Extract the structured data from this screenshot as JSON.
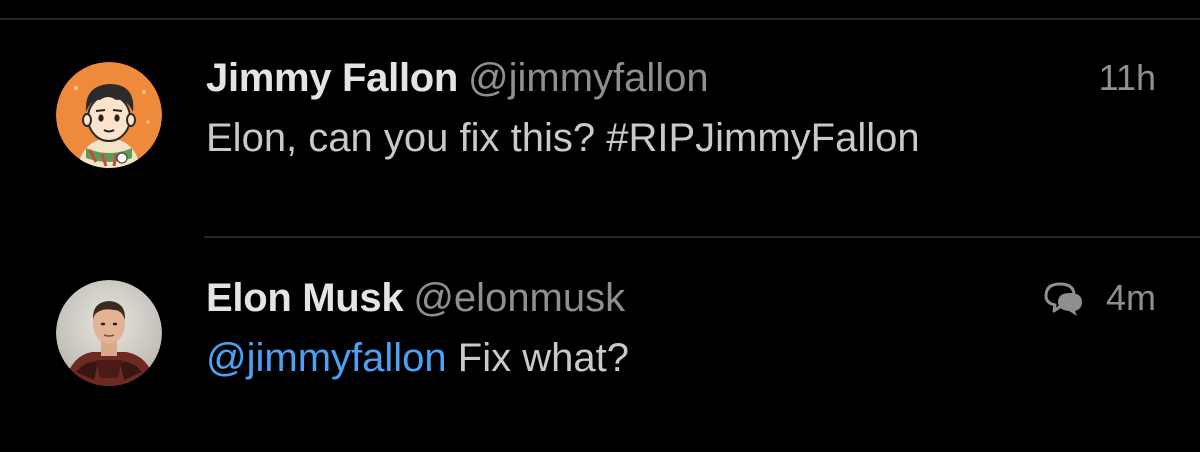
{
  "feed": {
    "tweets": [
      {
        "display_name": "Jimmy Fallon",
        "handle": "@jimmyfallon",
        "timestamp": "11h",
        "text": "Elon, can you fix this? #RIPJimmyFallon",
        "avatar_icon": "cartoon-avatar"
      },
      {
        "display_name": "Elon Musk",
        "handle": "@elonmusk",
        "timestamp": "4m",
        "mention": "@jimmyfallon",
        "text": " Fix what?",
        "status_icon": "conversation-icon",
        "avatar_icon": "photo-avatar"
      }
    ]
  },
  "colors": {
    "background": "#000000",
    "mention": "#4aa1f5",
    "secondary_text": "#8f8f8f",
    "divider": "#262626"
  }
}
